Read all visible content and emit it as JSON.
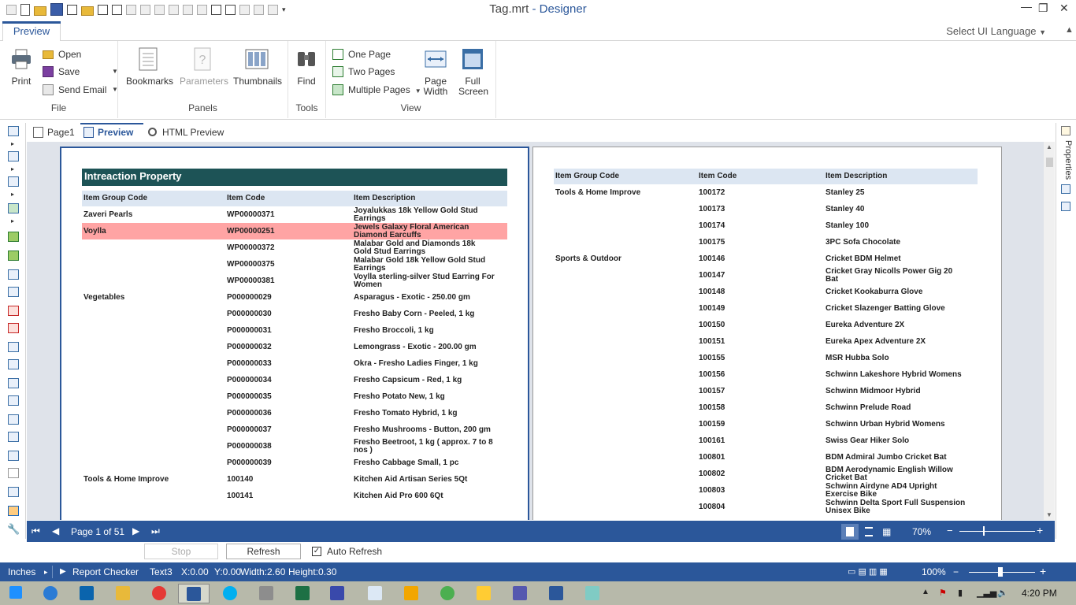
{
  "window": {
    "filename": "Tag.mrt",
    "separator": " - ",
    "appname": "Designer"
  },
  "ribbon_tab": "Preview",
  "select_language": "Select UI Language",
  "ribbon": {
    "file": {
      "label": "File",
      "print": "Print",
      "open": "Open",
      "save": "Save",
      "send_email": "Send Email"
    },
    "panels": {
      "label": "Panels",
      "bookmarks": "Bookmarks",
      "parameters": "Parameters",
      "thumbnails": "Thumbnails"
    },
    "tools": {
      "label": "Tools",
      "find": "Find"
    },
    "view": {
      "label": "View",
      "one_page": "One Page",
      "two_pages": "Two Pages",
      "multiple_pages": "Multiple Pages",
      "page_width_1": "Page",
      "page_width_2": "Width",
      "full_screen_1": "Full",
      "full_screen_2": "Screen"
    }
  },
  "doc_tabs": {
    "page1": "Page1",
    "preview": "Preview",
    "html_preview": "HTML Preview"
  },
  "properties_label": "Properties",
  "report": {
    "title": "Intreaction Property",
    "headers": {
      "group": "Item Group Code",
      "code": "Item Code",
      "desc": "Item Description"
    },
    "page1_rows": [
      {
        "group": "Zaveri Pearls",
        "code": "WP00000371",
        "desc": "Joyalukkas 18k Yellow Gold Stud Earrings"
      },
      {
        "group": "Voylla",
        "code": "WP00000251",
        "desc": "Jewels Galaxy Floral American Diamond Earcuffs",
        "highlight": true
      },
      {
        "group": "",
        "code": "WP00000372",
        "desc": "Malabar Gold and Diamonds 18k Gold Stud Earrings"
      },
      {
        "group": "",
        "code": "WP00000375",
        "desc": "Malabar Gold 18k Yellow Gold Stud Earrings"
      },
      {
        "group": "",
        "code": "WP00000381",
        "desc": "Voylla sterling-silver Stud Earring For Women"
      },
      {
        "group": "Vegetables",
        "code": "P000000029",
        "desc": "Asparagus - Exotic - 250.00 gm"
      },
      {
        "group": "",
        "code": "P000000030",
        "desc": "Fresho Baby Corn - Peeled, 1 kg"
      },
      {
        "group": "",
        "code": "P000000031",
        "desc": "Fresho Broccoli, 1 kg"
      },
      {
        "group": "",
        "code": "P000000032",
        "desc": "Lemongrass - Exotic - 200.00 gm"
      },
      {
        "group": "",
        "code": "P000000033",
        "desc": "Okra - Fresho Ladies Finger, 1 kg"
      },
      {
        "group": "",
        "code": "P000000034",
        "desc": "Fresho Capsicum - Red, 1 kg"
      },
      {
        "group": "",
        "code": "P000000035",
        "desc": "Fresho Potato New, 1 kg"
      },
      {
        "group": "",
        "code": "P000000036",
        "desc": "Fresho Tomato Hybrid, 1 kg"
      },
      {
        "group": "",
        "code": "P000000037",
        "desc": "Fresho Mushrooms - Button, 200 gm"
      },
      {
        "group": "",
        "code": "P000000038",
        "desc": "Fresho Beetroot, 1 kg ( approx. 7 to 8 nos )"
      },
      {
        "group": "",
        "code": "P000000039",
        "desc": "Fresho Cabbage Small, 1 pc"
      },
      {
        "group": "Tools & Home Improve",
        "code": "100140",
        "desc": "Kitchen Aid Artisan Series 5Qt"
      },
      {
        "group": "",
        "code": "100141",
        "desc": "Kitchen Aid Pro 600 6Qt"
      }
    ],
    "page2_rows": [
      {
        "group": "Tools & Home Improve",
        "code": "100172",
        "desc": "Stanley 25"
      },
      {
        "group": "",
        "code": "100173",
        "desc": "Stanley 40"
      },
      {
        "group": "",
        "code": "100174",
        "desc": "Stanley 100"
      },
      {
        "group": "",
        "code": "100175",
        "desc": "3PC Sofa Chocolate"
      },
      {
        "group": "Sports & Outdoor",
        "code": "100146",
        "desc": "Cricket BDM Helmet"
      },
      {
        "group": "",
        "code": "100147",
        "desc": "Cricket Gray Nicolls Power Gig 20 Bat"
      },
      {
        "group": "",
        "code": "100148",
        "desc": "Cricket Kookaburra Glove"
      },
      {
        "group": "",
        "code": "100149",
        "desc": "Cricket Slazenger Batting Glove"
      },
      {
        "group": "",
        "code": "100150",
        "desc": "Eureka Adventure 2X"
      },
      {
        "group": "",
        "code": "100151",
        "desc": "Eureka Apex Adventure 2X"
      },
      {
        "group": "",
        "code": "100155",
        "desc": "MSR Hubba Solo"
      },
      {
        "group": "",
        "code": "100156",
        "desc": "Schwinn Lakeshore Hybrid Womens"
      },
      {
        "group": "",
        "code": "100157",
        "desc": "Schwinn Midmoor Hybrid"
      },
      {
        "group": "",
        "code": "100158",
        "desc": "Schwinn Prelude Road"
      },
      {
        "group": "",
        "code": "100159",
        "desc": "Schwinn Urban Hybrid Womens"
      },
      {
        "group": "",
        "code": "100161",
        "desc": "Swiss Gear Hiker Solo"
      },
      {
        "group": "",
        "code": "100801",
        "desc": "BDM Admiral Jumbo Cricket Bat"
      },
      {
        "group": "",
        "code": "100802",
        "desc": "BDM Aerodynamic English Willow Cricket Bat"
      },
      {
        "group": "",
        "code": "100803",
        "desc": "Schwinn Airdyne AD4 Upright Exercise Bike"
      },
      {
        "group": "",
        "code": "100804",
        "desc": "Schwinn Delta Sport Full Suspension Unisex Bike"
      }
    ]
  },
  "nav": {
    "page_info": "Page 1 of 51",
    "zoom": "70%"
  },
  "auto": {
    "stop": "Stop",
    "refresh": "Refresh",
    "auto_refresh": "Auto Refresh",
    "checked": "✓"
  },
  "status": {
    "units": "Inches",
    "report_checker": "Report Checker",
    "component": "Text3",
    "x": "X:0.00",
    "y": "Y:0.00",
    "width": "Width:2.60",
    "height": "Height:0.30",
    "zoom": "100%"
  },
  "taskbar": {
    "time": "4:20 PM"
  },
  "colors": {
    "accent": "#2b579a",
    "title_bar": "#1d5356",
    "header_bg": "#dce6f2",
    "highlight": "#ffa4a4"
  }
}
